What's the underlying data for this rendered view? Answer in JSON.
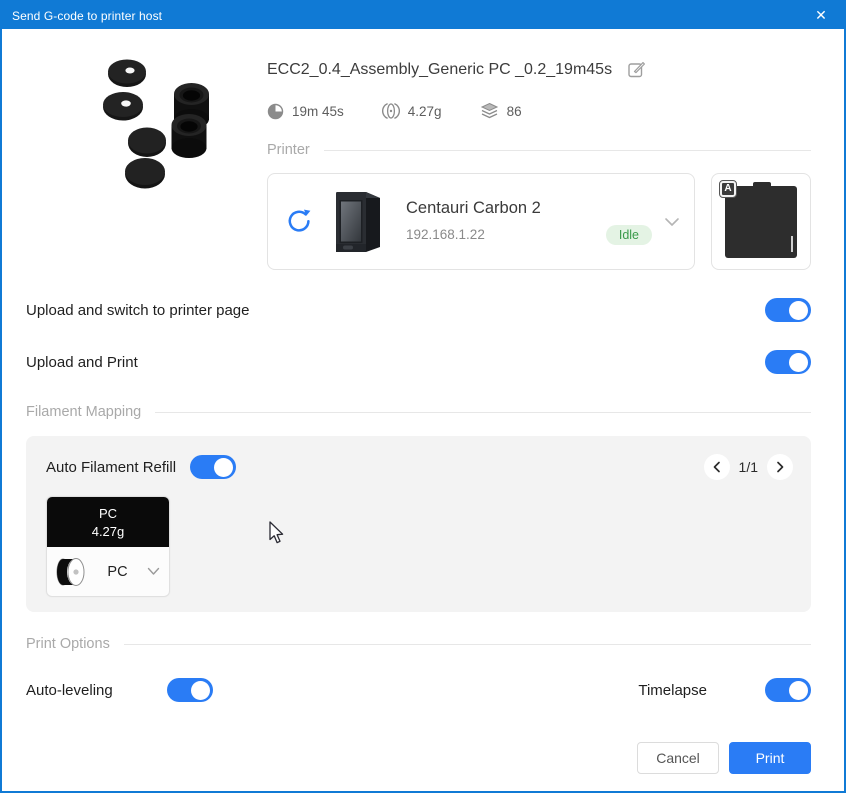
{
  "titlebar": {
    "title": "Send G-code to printer host",
    "close_glyph": "✕"
  },
  "file": {
    "name": "ECC2_0.4_Assembly_Generic PC _0.2_19m45s",
    "print_time": "19m 45s",
    "filament_weight": "4.27g",
    "layer_count": "86"
  },
  "printer": {
    "section_label": "Printer",
    "name": "Centauri Carbon 2",
    "ip": "192.168.1.22",
    "status": "Idle",
    "plate_badge": "A"
  },
  "upload_options": [
    {
      "label": "Upload and switch to printer page",
      "on": true
    },
    {
      "label": "Upload and Print",
      "on": true
    }
  ],
  "filament_mapping": {
    "section_label": "Filament Mapping",
    "auto_refill_label": "Auto Filament Refill",
    "auto_refill_on": true,
    "page_indicator": "1/1",
    "slot": {
      "material": "PC",
      "weight": "4.27g",
      "mapped_material": "PC"
    }
  },
  "print_options": {
    "section_label": "Print Options",
    "auto_leveling_label": "Auto-leveling",
    "auto_leveling_on": true,
    "timelapse_label": "Timelapse",
    "timelapse_on": true
  },
  "footer": {
    "cancel_label": "Cancel",
    "print_label": "Print"
  },
  "colors": {
    "titlebar": "#107ad5",
    "accent": "#2a7cf5",
    "status_bg": "#e4f3e4",
    "status_text": "#3a9a4a"
  }
}
